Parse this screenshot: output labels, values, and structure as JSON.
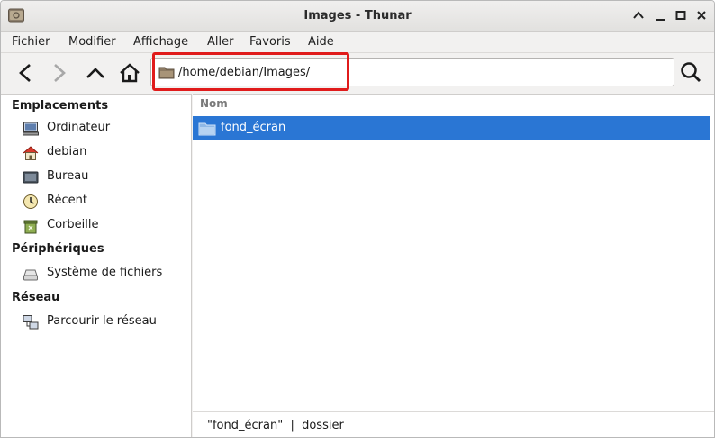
{
  "window": {
    "title": "Images - Thunar"
  },
  "menubar": {
    "items": [
      "Fichier",
      "Modifier",
      "Affichage",
      "Aller",
      "Favoris",
      "Aide"
    ]
  },
  "toolbar": {
    "location": "/home/debian/Images/",
    "icons": [
      "back-arrow-icon",
      "forward-arrow-icon",
      "up-arrow-icon",
      "home-icon",
      "search-icon"
    ]
  },
  "sidebar": {
    "sections": [
      {
        "title": "Emplacements",
        "items": [
          {
            "label": "Ordinateur",
            "icon": "computer-icon"
          },
          {
            "label": "debian",
            "icon": "user-home-icon"
          },
          {
            "label": "Bureau",
            "icon": "desktop-icon"
          },
          {
            "label": "Récent",
            "icon": "recent-clock-icon"
          },
          {
            "label": "Corbeille",
            "icon": "trash-icon"
          }
        ]
      },
      {
        "title": "Périphériques",
        "items": [
          {
            "label": "Système de fichiers",
            "icon": "drive-icon"
          }
        ]
      },
      {
        "title": "Réseau",
        "items": [
          {
            "label": "Parcourir le réseau",
            "icon": "network-icon"
          }
        ]
      }
    ]
  },
  "files": {
    "column_header": "Nom",
    "rows": [
      {
        "name": "fond_écran",
        "icon": "folder-icon",
        "selected": true
      }
    ]
  },
  "statusbar": {
    "text": "\"fond_écran\"  |  dossier"
  },
  "colors": {
    "selection": "#2a76d4",
    "highlight_box": "#e01b1b"
  }
}
